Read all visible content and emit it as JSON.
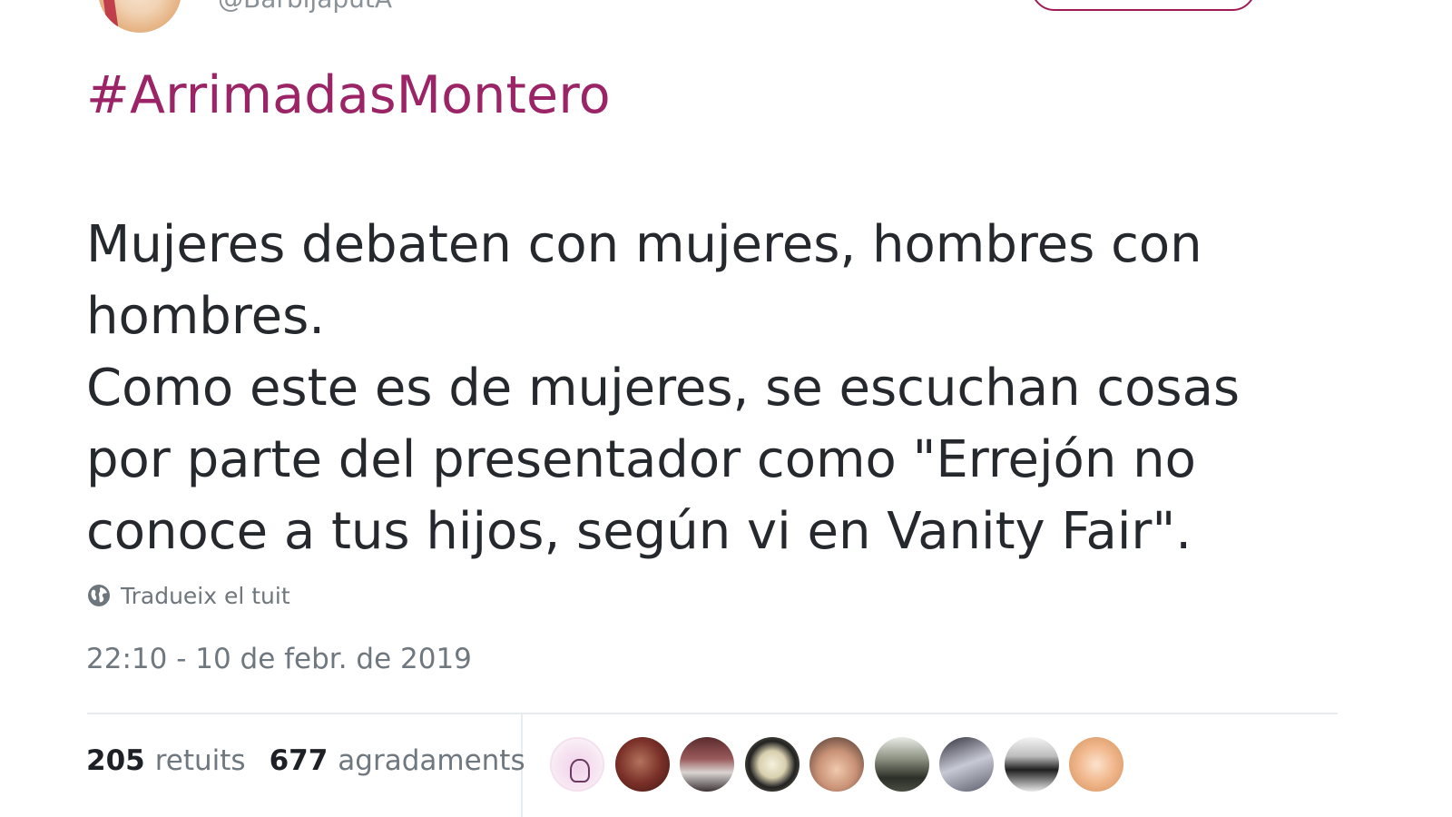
{
  "header": {
    "handle": "@BarbijaputA"
  },
  "tweet": {
    "hashtag": "#ArrimadasMontero",
    "text_lines": [
      "Mujeres debaten con mujeres, hombres con",
      "hombres.",
      "Como este es de mujeres, se escuchan cosas",
      "por parte del presentador como \"Errejón no",
      "conoce a tus hijos, según vi en Vanity Fair\"."
    ],
    "translate_label": "Tradueix el tuit",
    "timestamp": "22:10 - 10 de febr. de 2019"
  },
  "stats": {
    "retweets_count": "205",
    "retweets_label": "retuits",
    "likes_count": "677",
    "likes_label": "agradaments"
  },
  "icons": {
    "translate": "globe-icon"
  },
  "colors": {
    "hashtag": "#9b2467",
    "follow_border": "#a01b56",
    "secondary_text": "#6f777f",
    "divider": "#e6ecf0"
  }
}
